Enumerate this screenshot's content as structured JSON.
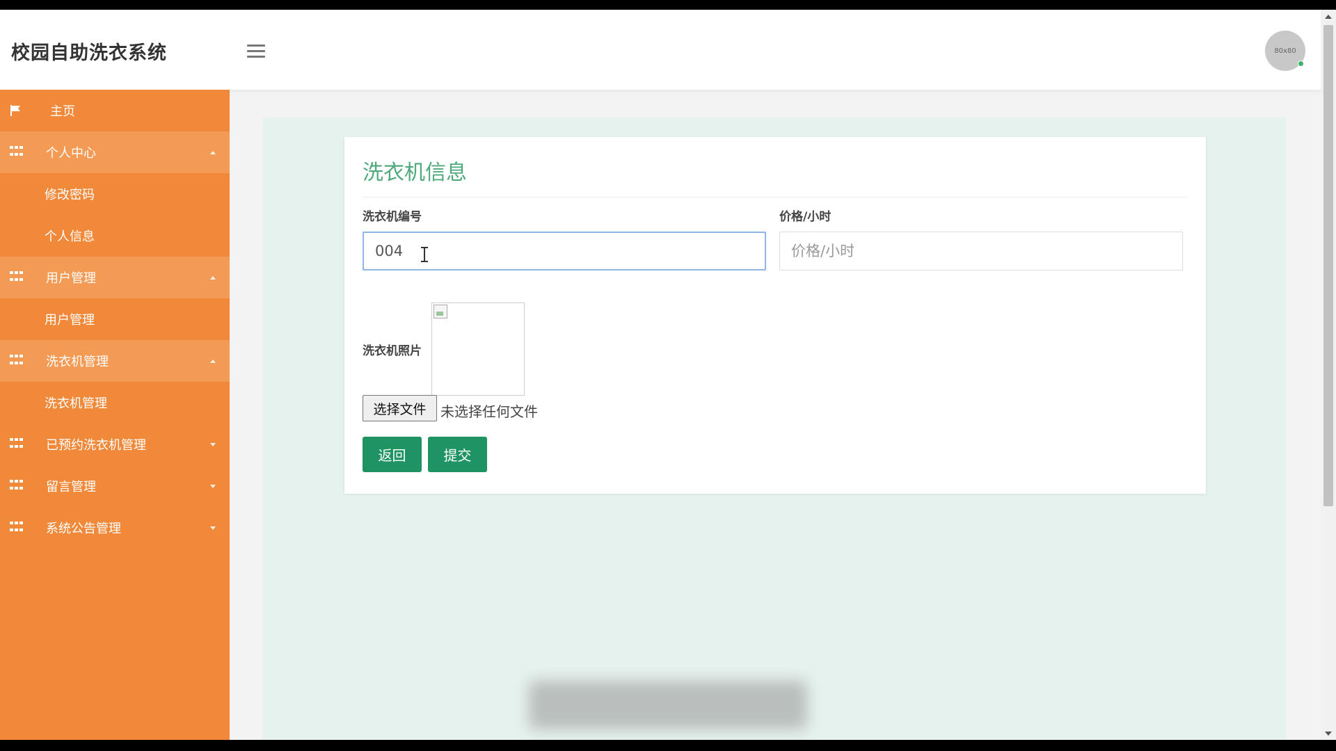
{
  "header": {
    "title": "校园自助洗衣系统",
    "menu_icon": "hamburger-icon",
    "avatar_text": "80x80"
  },
  "sidebar": {
    "items": [
      {
        "label": "主页",
        "icon": "flag-icon"
      },
      {
        "label": "个人中心",
        "icon": "grid-icon",
        "expanded": true,
        "children": [
          "修改密码",
          "个人信息"
        ]
      },
      {
        "label": "用户管理",
        "icon": "grid-icon",
        "expanded": true,
        "children": [
          "用户管理"
        ]
      },
      {
        "label": "洗衣机管理",
        "icon": "grid-icon",
        "expanded": true,
        "children": [
          "洗衣机管理"
        ]
      },
      {
        "label": "已预约洗衣机管理",
        "icon": "grid-icon",
        "expanded": false
      },
      {
        "label": "留言管理",
        "icon": "grid-icon",
        "expanded": false
      },
      {
        "label": "系统公告管理",
        "icon": "grid-icon",
        "expanded": false
      }
    ]
  },
  "form": {
    "title": "洗衣机信息",
    "number_label": "洗衣机编号",
    "number_value": "004",
    "price_label": "价格/小时",
    "price_placeholder": "价格/小时",
    "photo_label": "洗衣机照片",
    "file_button": "选择文件",
    "file_status": "未选择任何文件",
    "back_button": "返回",
    "submit_button": "提交"
  },
  "colors": {
    "sidebar": "#f0893a",
    "sidebar_group": "#f39a55",
    "accent_green": "#1f9462",
    "title_green": "#4fa97a",
    "content_bg": "#e6f2ee"
  }
}
